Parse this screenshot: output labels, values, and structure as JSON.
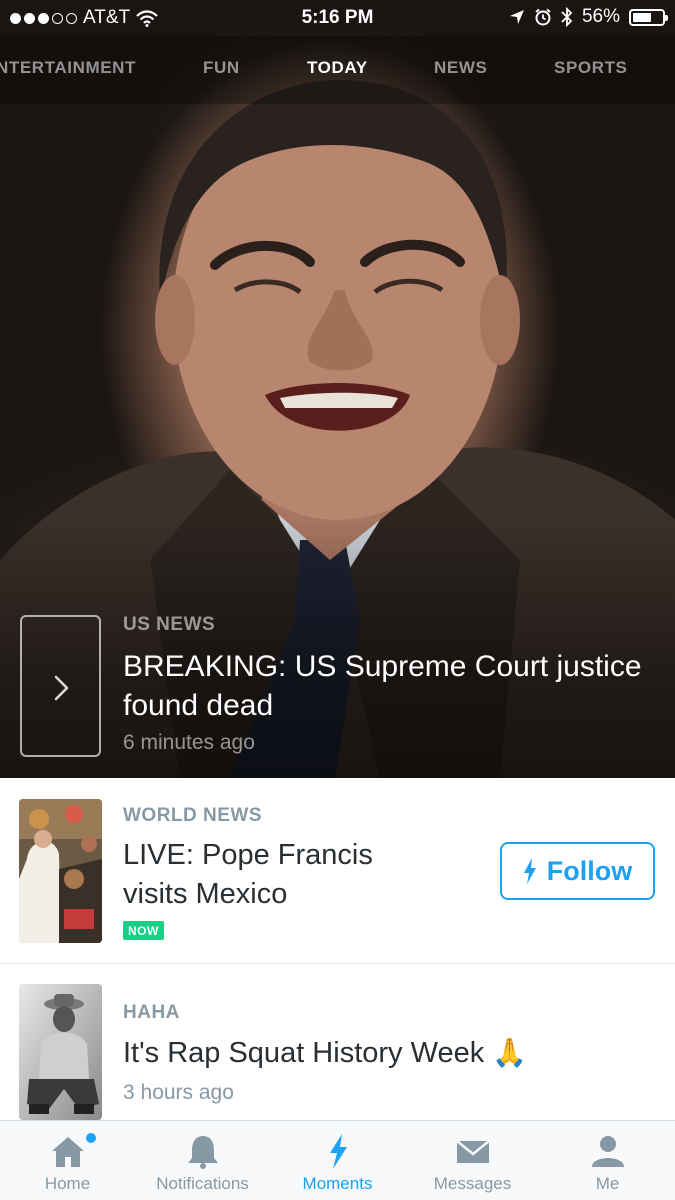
{
  "status_bar": {
    "carrier": "AT&T",
    "time": "5:16 PM",
    "battery_percent_label": "56%",
    "battery_level": 0.56,
    "signal_bars_filled": 3,
    "signal_bars_total": 5
  },
  "category_tabs": [
    {
      "label": "NTERTAINMENT",
      "active": false
    },
    {
      "label": "FUN",
      "active": false
    },
    {
      "label": "TODAY",
      "active": true
    },
    {
      "label": "NEWS",
      "active": false
    },
    {
      "label": "SPORTS",
      "active": false
    }
  ],
  "hero": {
    "category": "US NEWS",
    "title": "BREAKING: US Supreme Court justice found dead",
    "time": "6 minutes ago"
  },
  "moments": [
    {
      "category": "WORLD NEWS",
      "title": "LIVE: Pope Francis visits Mexico",
      "badge": "NOW",
      "follow_label": "Follow"
    },
    {
      "category": "HAHA",
      "title": "It's Rap Squat History Week",
      "emoji": "🙏",
      "time": "3 hours ago"
    }
  ],
  "tab_bar": [
    {
      "label": "Home",
      "icon": "home-icon",
      "active": false,
      "has_badge": true
    },
    {
      "label": "Notifications",
      "icon": "bell-icon",
      "active": false
    },
    {
      "label": "Moments",
      "icon": "lightning-icon",
      "active": true
    },
    {
      "label": "Messages",
      "icon": "envelope-icon",
      "active": false
    },
    {
      "label": "Me",
      "icon": "person-icon",
      "active": false
    }
  ],
  "colors": {
    "accent": "#1da1f2",
    "now_badge": "#19cf86",
    "inactive": "#8899a6",
    "text": "#292f33"
  }
}
